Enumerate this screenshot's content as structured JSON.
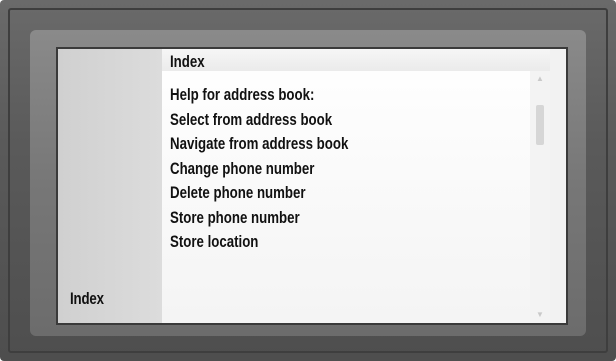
{
  "left_panel": {
    "label": "Index"
  },
  "header": {
    "title": "Index"
  },
  "menu": {
    "items": [
      {
        "label": "Help for address book:"
      },
      {
        "label": "Select from address book"
      },
      {
        "label": "Navigate from address book"
      },
      {
        "label": "Change phone number"
      },
      {
        "label": "Delete phone number"
      },
      {
        "label": "Store phone number"
      },
      {
        "label": "Store location"
      }
    ]
  },
  "icons": {
    "scroll_up": "chevron-up-icon",
    "scroll_down": "chevron-down-icon"
  }
}
